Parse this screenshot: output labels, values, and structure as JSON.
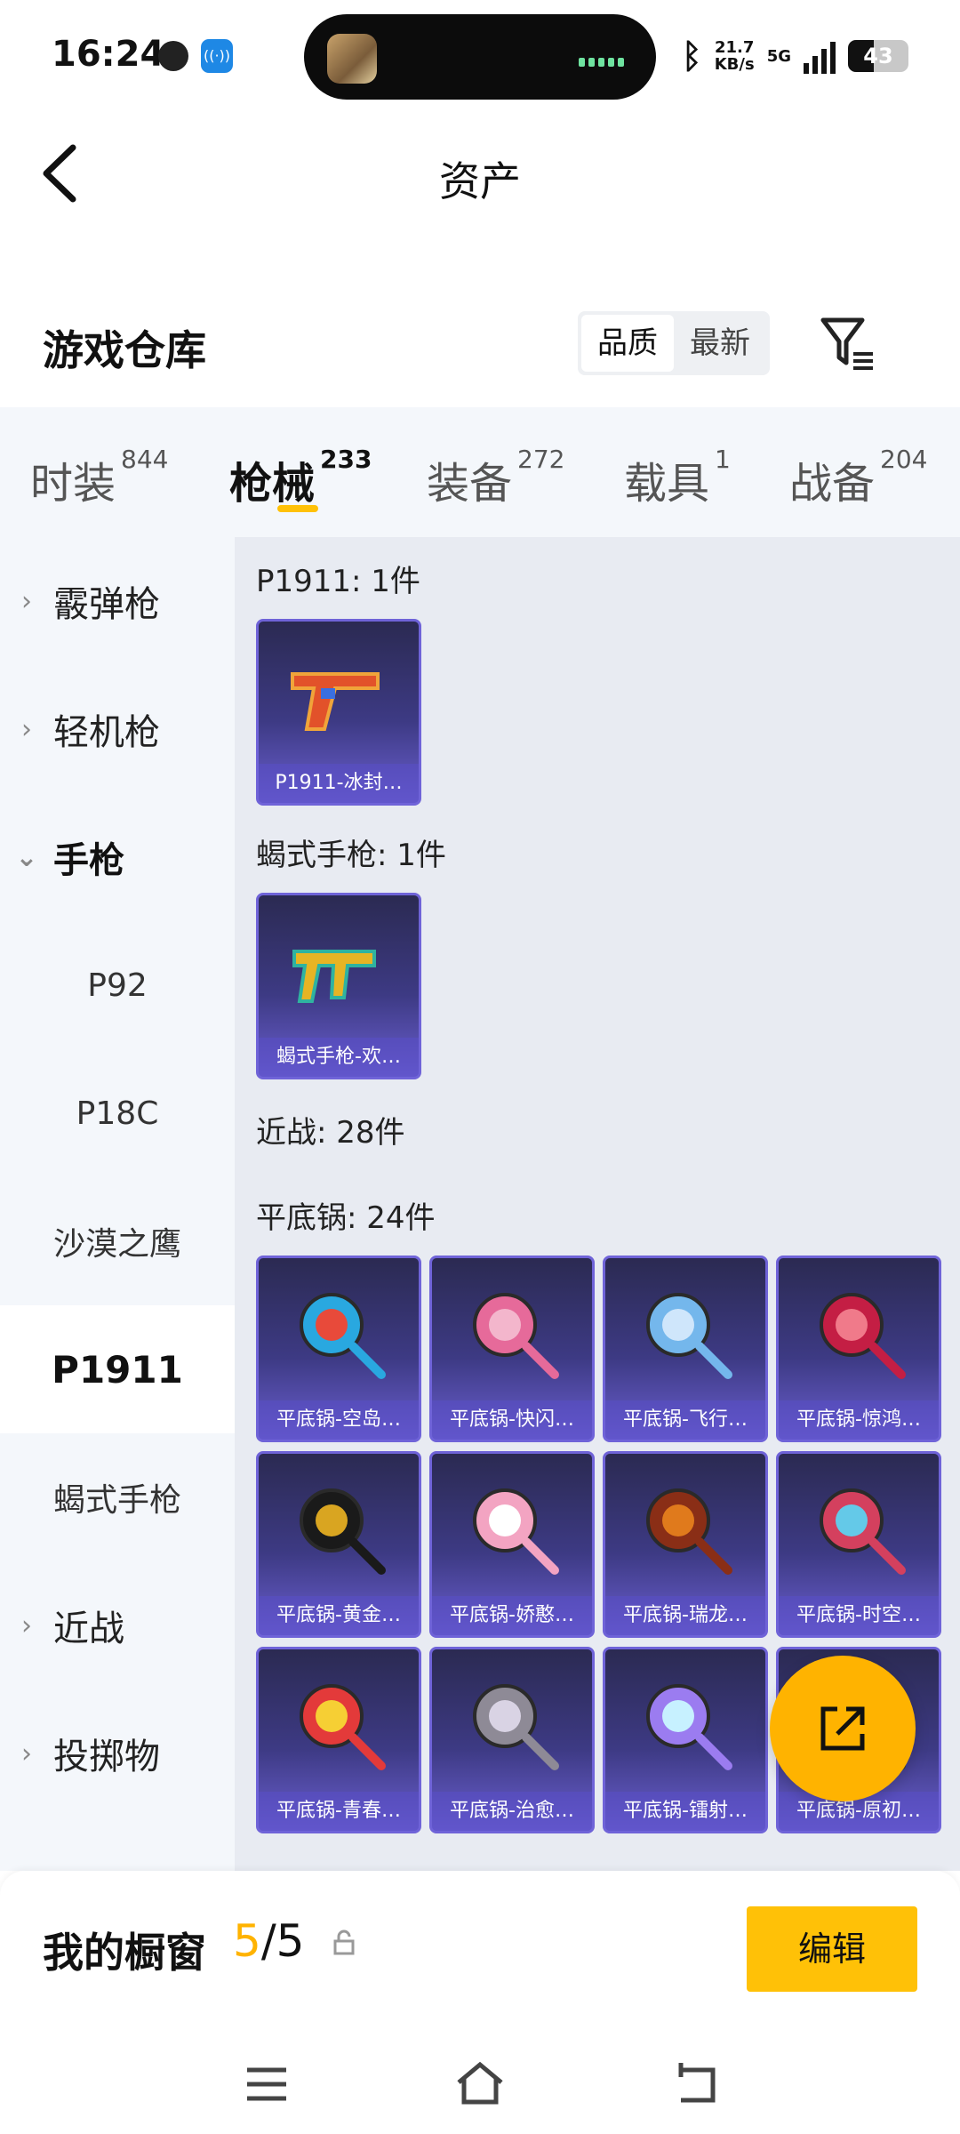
{
  "status_bar": {
    "time": "16:24",
    "net_speed_value": "21.7",
    "net_speed_unit": "KB/s",
    "network": "5G",
    "battery": "43"
  },
  "header": {
    "title": "资产"
  },
  "warehouse": {
    "title": "游戏仓库",
    "sort": [
      "品质",
      "最新"
    ]
  },
  "tabs": [
    {
      "label": "时装",
      "count": "844"
    },
    {
      "label": "枪械",
      "count": "233"
    },
    {
      "label": "装备",
      "count": "272"
    },
    {
      "label": "载具",
      "count": "1"
    },
    {
      "label": "战备",
      "count": "204"
    }
  ],
  "sidebar": [
    {
      "label": "霰弹枪"
    },
    {
      "label": "轻机枪"
    },
    {
      "label": "手枪"
    },
    {
      "label": "P92"
    },
    {
      "label": "P18C"
    },
    {
      "label": "沙漠之鹰"
    },
    {
      "label": "P1911"
    },
    {
      "label": "蝎式手枪"
    },
    {
      "label": "近战"
    },
    {
      "label": "投掷物"
    }
  ],
  "groups": {
    "p1911": {
      "title": "P1911: 1件",
      "items": [
        "P1911-冰封…"
      ]
    },
    "scorpion": {
      "title": "蝎式手枪: 1件",
      "items": [
        "蝎式手枪-欢…"
      ]
    },
    "melee": {
      "title": "近战: 28件"
    },
    "pan": {
      "title": "平底锅: 24件",
      "items": [
        "平底锅-空岛…",
        "平底锅-快闪…",
        "平底锅-飞行…",
        "平底锅-惊鸿…",
        "平底锅-黄金…",
        "平底锅-娇憨…",
        "平底锅-瑞龙…",
        "平底锅-时空…",
        "平底锅-青春…",
        "平底锅-治愈…",
        "平底锅-镭射…",
        "平底锅-原初…"
      ]
    }
  },
  "showcase": {
    "label": "我的橱窗",
    "current": "5",
    "total": "/5",
    "edit": "编辑"
  },
  "colors": {
    "accent": "#ffc107",
    "card_bg": "#3d3a84",
    "card_border": "#6f63d8"
  }
}
